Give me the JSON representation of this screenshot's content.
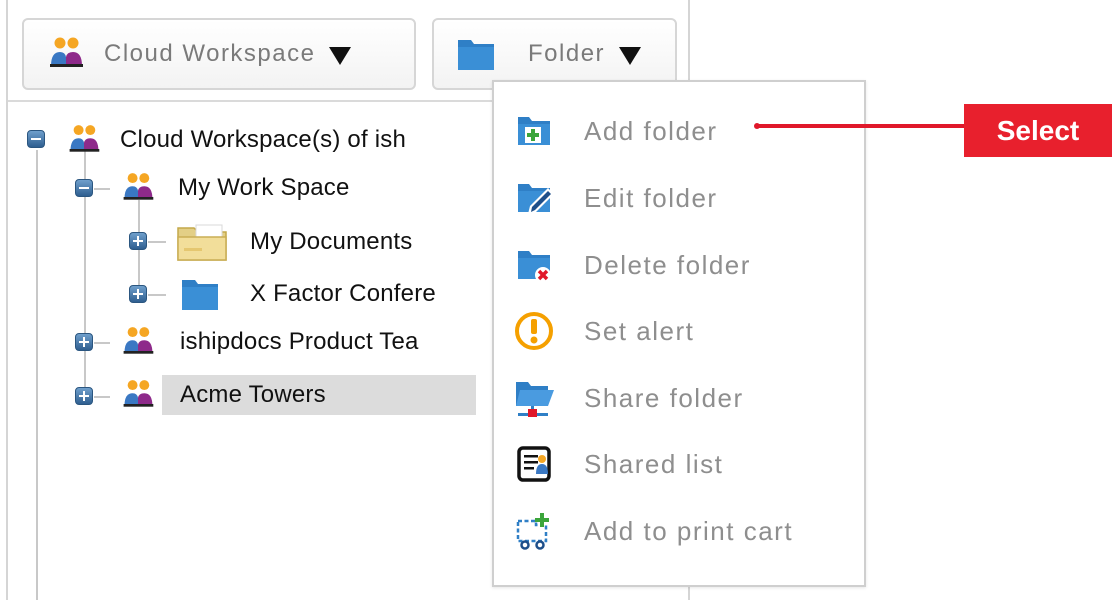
{
  "toolbar": {
    "workspace_button": {
      "label": "Cloud Workspace",
      "icon": "people-icon"
    },
    "folder_button": {
      "label": "Folder",
      "icon": "folder-icon"
    }
  },
  "tree": {
    "root": {
      "label": "Cloud Workspace(s) of ish",
      "icon": "people-icon",
      "expanded": true
    },
    "my_work_space": {
      "label": "My Work Space",
      "icon": "people-icon",
      "expanded": true
    },
    "my_documents": {
      "label": "My Documents",
      "icon": "open-folder-icon"
    },
    "x_factor": {
      "label": "X Factor Confere",
      "icon": "folder-icon"
    },
    "product_team": {
      "label": "ishipdocs Product Tea",
      "icon": "people-icon"
    },
    "acme_towers": {
      "label": "Acme Towers",
      "icon": "people-icon",
      "selected": true
    }
  },
  "menu": {
    "items": [
      {
        "label": "Add folder",
        "icon": "add-folder-icon"
      },
      {
        "label": "Edit folder",
        "icon": "edit-folder-icon"
      },
      {
        "label": "Delete folder",
        "icon": "delete-folder-icon"
      },
      {
        "label": "Set alert",
        "icon": "alert-icon"
      },
      {
        "label": "Share folder",
        "icon": "share-folder-icon"
      },
      {
        "label": "Shared list",
        "icon": "shared-list-icon"
      },
      {
        "label": "Add to print cart",
        "icon": "print-cart-icon"
      }
    ]
  },
  "callout": {
    "label": "Select"
  },
  "colors": {
    "accent_red": "#e8202d",
    "folder_blue": "#2f7fc6",
    "people_orange": "#f5a623",
    "people_purple": "#8e2a8a"
  }
}
